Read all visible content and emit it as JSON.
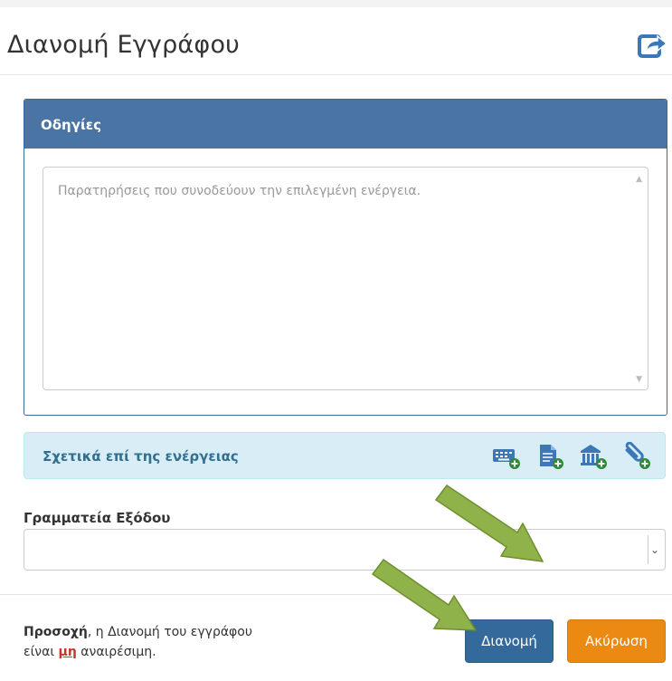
{
  "header": {
    "title": "Διανομή Εγγράφου",
    "share_icon": "share-icon"
  },
  "instructions": {
    "title": "Οδηγίες",
    "textarea_value": "",
    "textarea_placeholder": "Παρατηρήσεις που συνοδεύουν την επιλεγμένη ενέργεια."
  },
  "related": {
    "label": "Σχετικά επί της ενέργειας",
    "icons": [
      "keyboard-add-icon",
      "document-add-icon",
      "institution-add-icon",
      "attachment-add-icon"
    ]
  },
  "secretariat": {
    "label": "Γραμματεία Εξόδου",
    "selected": ""
  },
  "footer": {
    "warning_bold": "Προσοχή",
    "warning_text1": ", η Διανομή του εγγράφου",
    "warning_text2_a": "είναι ",
    "warning_emph": "μη",
    "warning_text2_b": " αναιρέσιμη.",
    "primary_label": "Διανομή",
    "cancel_label": "Ακύρωση"
  },
  "colors": {
    "panel_header": "#4a74a4",
    "info_bg": "#d9edf7",
    "info_text": "#31708f",
    "primary": "#34699c",
    "warning_button": "#ea8a12",
    "arrow": "#8fb34a"
  }
}
